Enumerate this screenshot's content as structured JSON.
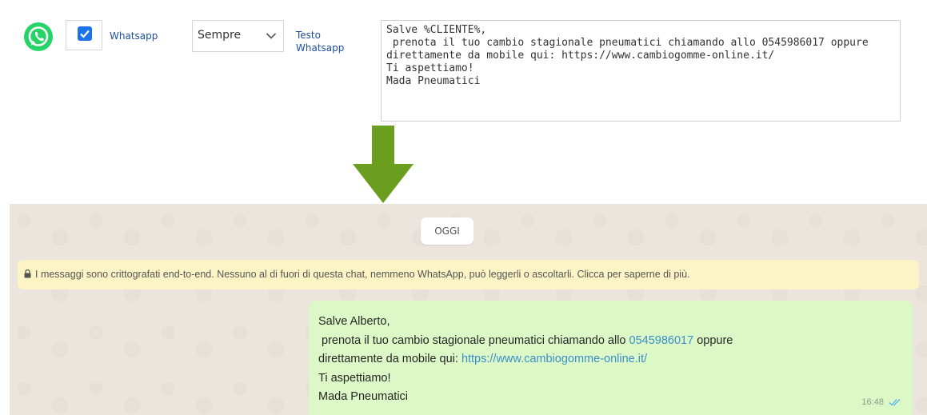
{
  "settings_row": {
    "channel_label": "Whatsapp",
    "frequency_selected": "Sempre",
    "text_label_line1": "Testo",
    "text_label_line2": "Whatsapp",
    "template_lines": [
      "Salve %CLIENTE%,",
      " prenota il tuo cambio stagionale pneumatici chiamando allo 0545986017 oppure",
      "direttamente da mobile qui: https://www.cambiogomme-online.it/",
      "Ti aspettiamo!",
      "Mada Pneumatici"
    ],
    "checkbox_checked": true
  },
  "chat": {
    "day_label": "OGGI",
    "encryption_notice": "I messaggi sono crittografati end-to-end. Nessuno al di fuori di questa chat, nemmeno WhatsApp, può leggerli o ascoltarli. Clicca per saperne di più.",
    "message": {
      "line1": "Salve Alberto,",
      "line2_prefix": " prenota il tuo cambio stagionale pneumatici chiamando allo ",
      "phone": "0545986017",
      "line2_suffix": " oppure",
      "line3_prefix": "direttamente da mobile qui: ",
      "url": "https://www.cambiogomme-online.it/",
      "line4": "Ti aspettiamo!",
      "line5": "Mada Pneumatici",
      "time": "16:48"
    }
  },
  "colors": {
    "whatsapp_green": "#25d366",
    "arrow_green": "#6b9e1f",
    "bubble_green": "#dcf8c6",
    "notice_yellow": "#fdf4c5",
    "link_blue": "#3a8fc9"
  },
  "icons": [
    "whatsapp-icon",
    "checkmark-icon",
    "chevron-down-icon",
    "arrow-down-icon",
    "lock-icon",
    "double-check-icon"
  ]
}
